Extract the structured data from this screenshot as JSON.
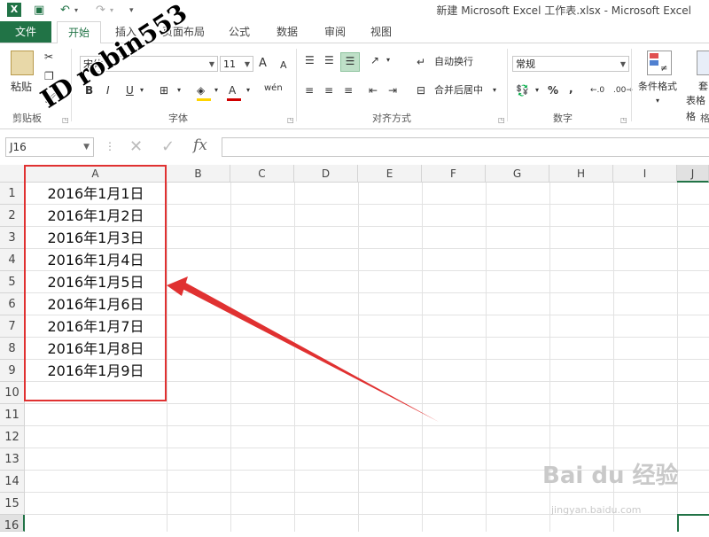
{
  "window": {
    "title": "新建 Microsoft Excel 工作表.xlsx - Microsoft Excel"
  },
  "tabs": [
    "文件",
    "开始",
    "插入",
    "页面布局",
    "公式",
    "数据",
    "审阅",
    "视图"
  ],
  "ribbon": {
    "clipboard": {
      "paste_label": "粘贴",
      "group_label": "剪贴板"
    },
    "font": {
      "font_name": "宋体",
      "font_size": "11",
      "bold": "B",
      "italic": "I",
      "underline": "U",
      "grow": "A",
      "shrink": "A",
      "font_color": "A",
      "wen": "wén",
      "group_label": "字体"
    },
    "alignment": {
      "wrap_text": "自动换行",
      "merge_center": "合并后居中",
      "group_label": "对齐方式"
    },
    "number": {
      "format": "常规",
      "percent": "%",
      "comma": ",",
      "group_label": "数字"
    },
    "styles": {
      "conditional_format": "条件格式",
      "table_format_partial": "套",
      "table_format2": "表格格",
      "cell_style_partial": "格"
    }
  },
  "formula_bar": {
    "name_box": "J16",
    "fx": "fx"
  },
  "grid": {
    "columns": [
      "A",
      "B",
      "C",
      "D",
      "E",
      "F",
      "G",
      "H",
      "I",
      "J"
    ],
    "rows": [
      "1",
      "2",
      "3",
      "4",
      "5",
      "6",
      "7",
      "8",
      "9",
      "10",
      "11",
      "12",
      "13",
      "14",
      "15",
      "16"
    ],
    "column_a_values": [
      "2016年1月1日",
      "2016年1月2日",
      "2016年1月3日",
      "2016年1月4日",
      "2016年1月5日",
      "2016年1月6日",
      "2016年1月7日",
      "2016年1月8日",
      "2016年1月9日"
    ]
  },
  "watermark": {
    "text": "ID robin553"
  },
  "site_watermark": {
    "main": "Bai du 经验",
    "sub": "jingyan.baidu.com"
  },
  "colors": {
    "accent": "#217346",
    "annotation": "#e03131"
  }
}
